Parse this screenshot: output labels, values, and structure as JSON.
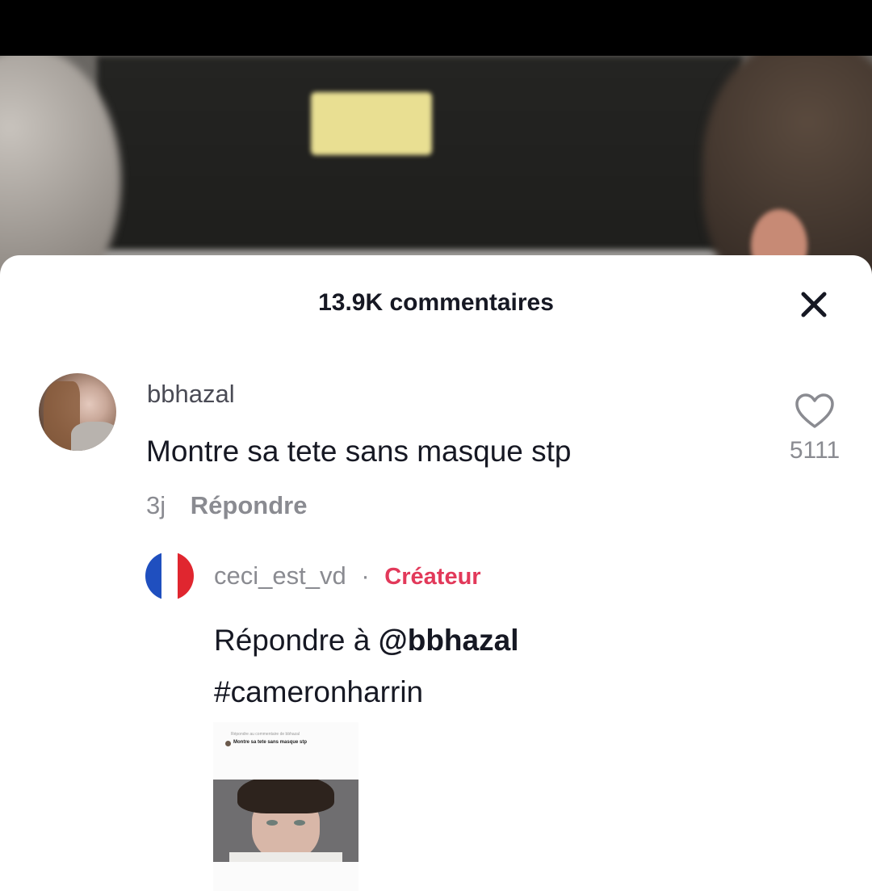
{
  "sheet": {
    "title": "13.9K commentaires"
  },
  "comment": {
    "username": "bbhazal",
    "text": "Montre sa tete sans masque stp",
    "time": "3j",
    "reply_label": "Répondre",
    "likes": "5111"
  },
  "reply": {
    "username": "ceci_est_vd",
    "separator": "·",
    "badge": "Créateur",
    "prefix": "Répondre à ",
    "mention": "@bbhazal",
    "hashtag": "#cameronharrin",
    "thumbnail_caption_top": "Répondre au commentaire de bbhazal",
    "thumbnail_caption": "Montre sa tete sans masque stp"
  },
  "colors": {
    "creator_badge": "#e2395a",
    "primary_text": "#161823",
    "secondary_text": "#8a8b91"
  }
}
